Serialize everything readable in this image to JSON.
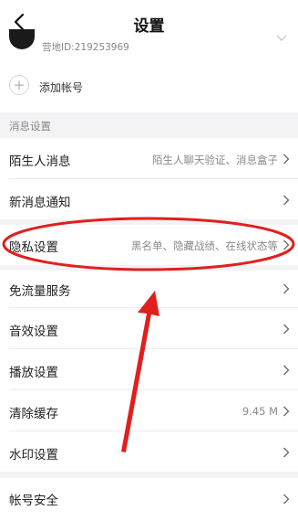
{
  "header": {
    "title": "设置"
  },
  "account": {
    "id_text": "营地ID:219253969"
  },
  "add_account": {
    "label": "添加帐号"
  },
  "section": {
    "title": "消息设置"
  },
  "rows": [
    {
      "label": "陌生人消息",
      "value": "陌生人聊天验证、消息盒子"
    },
    {
      "label": "新消息通知",
      "value": ""
    },
    {
      "label": "隐私设置",
      "value": "黑名单、隐藏战绩、在线状态等"
    },
    {
      "label": "免流量服务",
      "value": ""
    },
    {
      "label": "音效设置",
      "value": ""
    },
    {
      "label": "播放设置",
      "value": ""
    },
    {
      "label": "清除缓存",
      "value": "9.45 M"
    },
    {
      "label": "水印设置",
      "value": ""
    },
    {
      "label": "帐号安全",
      "value": ""
    }
  ],
  "colors": {
    "annotation": "#e0201e",
    "section_bg": "#f3f3f5"
  }
}
